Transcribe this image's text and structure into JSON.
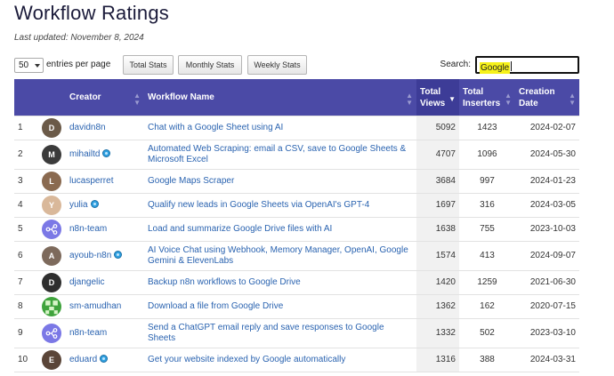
{
  "page": {
    "title": "Workflow Ratings",
    "updated": "Last updated: November 8, 2024"
  },
  "controls": {
    "page_length": "50",
    "entries_label": "entries per page",
    "buttons": {
      "total": "Total Stats",
      "monthly": "Monthly Stats",
      "weekly": "Weekly Stats"
    },
    "search_label": "Search:",
    "search_value": "Google"
  },
  "table": {
    "headers": {
      "creator": "Creator",
      "workflow": "Workflow Name",
      "views": "Total Views",
      "inserters": "Total Inserters",
      "date": "Creation Date"
    },
    "sorted_column": "views",
    "sort_direction": "descending",
    "rows": [
      {
        "num": "1",
        "creator": "davidn8n",
        "verified": false,
        "workflow": "Chat with a Google Sheet using AI",
        "views": "5092",
        "inserters": "1423",
        "date": "2024-02-07",
        "avatar": {
          "kind": "photo",
          "color": "#6b5a48",
          "initials": "D"
        }
      },
      {
        "num": "2",
        "creator": "mihailtd",
        "verified": true,
        "workflow": "Automated Web Scraping: email a CSV, save to Google Sheets & Microsoft Excel",
        "views": "4707",
        "inserters": "1096",
        "date": "2024-05-30",
        "avatar": {
          "kind": "photo",
          "color": "#3b3b3b",
          "initials": "M"
        }
      },
      {
        "num": "3",
        "creator": "lucasperret",
        "verified": false,
        "workflow": "Google Maps Scraper",
        "views": "3684",
        "inserters": "997",
        "date": "2024-01-23",
        "avatar": {
          "kind": "photo",
          "color": "#8a6a50",
          "initials": "L"
        }
      },
      {
        "num": "4",
        "creator": "yulia",
        "verified": true,
        "workflow": "Qualify new leads in Google Sheets via OpenAI's GPT-4",
        "views": "1697",
        "inserters": "316",
        "date": "2024-03-05",
        "avatar": {
          "kind": "photo",
          "color": "#d9b89a",
          "initials": "Y"
        }
      },
      {
        "num": "5",
        "creator": "n8n-team",
        "verified": false,
        "workflow": "Load and summarize Google Drive files with AI",
        "views": "1638",
        "inserters": "755",
        "date": "2023-10-03",
        "avatar": {
          "kind": "logo",
          "color": "#7b78e6",
          "initials": ""
        }
      },
      {
        "num": "6",
        "creator": "ayoub-n8n",
        "verified": true,
        "workflow": "AI Voice Chat using Webhook, Memory Manager, OpenAI, Google Gemini & ElevenLabs",
        "views": "1574",
        "inserters": "413",
        "date": "2024-09-07",
        "avatar": {
          "kind": "photo",
          "color": "#7d6a5c",
          "initials": "A"
        }
      },
      {
        "num": "7",
        "creator": "djangelic",
        "verified": false,
        "workflow": "Backup n8n workflows to Google Drive",
        "views": "1420",
        "inserters": "1259",
        "date": "2021-06-30",
        "avatar": {
          "kind": "photo",
          "color": "#2f2f2f",
          "initials": "D"
        }
      },
      {
        "num": "8",
        "creator": "sm-amudhan",
        "verified": false,
        "workflow": "Download a file from Google Drive",
        "views": "1362",
        "inserters": "162",
        "date": "2020-07-15",
        "avatar": {
          "kind": "pattern",
          "color": "#3fa33c",
          "initials": ""
        }
      },
      {
        "num": "9",
        "creator": "n8n-team",
        "verified": false,
        "workflow": "Send a ChatGPT email reply and save responses to Google Sheets",
        "views": "1332",
        "inserters": "502",
        "date": "2023-03-10",
        "avatar": {
          "kind": "logo",
          "color": "#7b78e6",
          "initials": ""
        }
      },
      {
        "num": "10",
        "creator": "eduard",
        "verified": true,
        "workflow": "Get your website indexed by Google automatically",
        "views": "1316",
        "inserters": "388",
        "date": "2024-03-31",
        "avatar": {
          "kind": "photo",
          "color": "#5a4538",
          "initials": "E"
        }
      }
    ]
  },
  "colors": {
    "header_bg": "#4b4aa6",
    "link": "#2a63b0",
    "search_highlight": "#f6f21b",
    "verified_badge": "#2fa0e0"
  }
}
